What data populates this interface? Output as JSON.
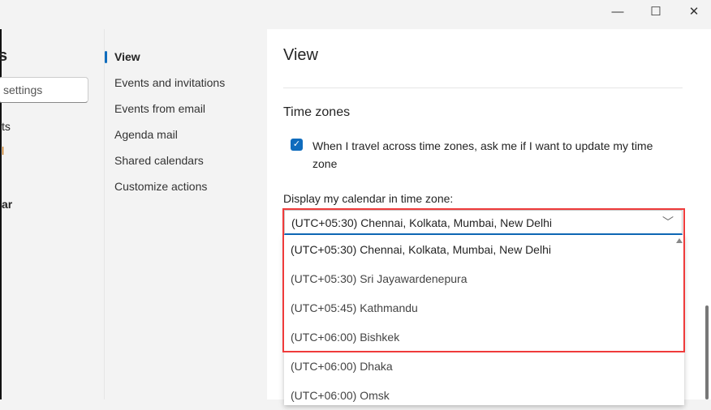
{
  "window": {
    "minimize": "—",
    "maximize": "☐",
    "close": "✕"
  },
  "left": {
    "title_fragment": "s",
    "search_placeholder": "settings",
    "item1": "ts",
    "item2": "l",
    "item3": "ar"
  },
  "nav": {
    "items": [
      "View",
      "Events and invitations",
      "Events from email",
      "Agenda mail",
      "Shared calendars",
      "Customize actions"
    ]
  },
  "main": {
    "title": "View",
    "section": "Time zones",
    "checkbox_label": "When I travel across time zones, ask me if I want to update my time zone",
    "checkbox_checked": true,
    "tz_label": "Display my calendar in time zone:",
    "tz_selected": "(UTC+05:30) Chennai, Kolkata, Mumbai, New Delhi",
    "options": [
      "(UTC+05:30) Chennai, Kolkata, Mumbai, New Delhi",
      "(UTC+05:30) Sri Jayawardenepura",
      "(UTC+05:45) Kathmandu",
      "(UTC+06:00) Bishkek",
      "(UTC+06:00) Dhaka",
      "(UTC+06:00) Omsk"
    ]
  },
  "colors": {
    "accent": "#0f6cbd",
    "highlight": "#ef3b3b"
  }
}
